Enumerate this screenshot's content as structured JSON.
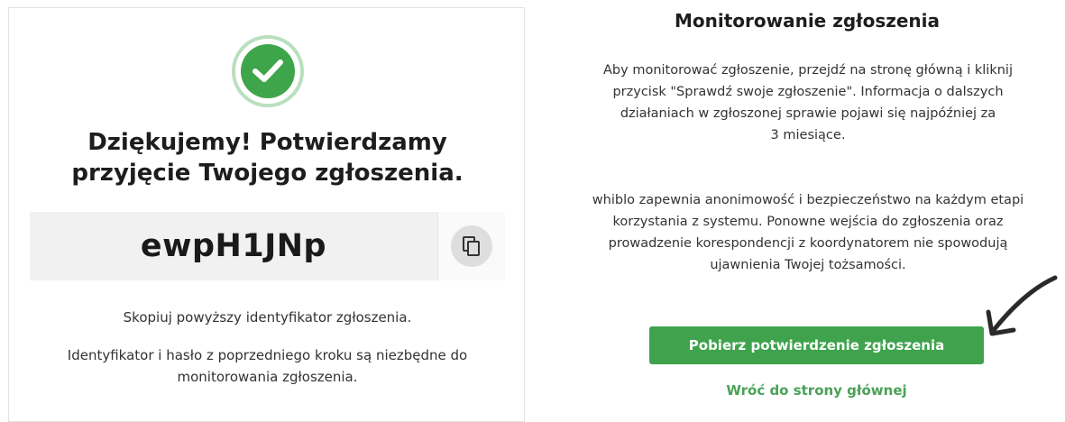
{
  "confirmation": {
    "heading_line1": "Dziękujemy! Potwierdzamy",
    "heading_line2": "przyjęcie Twojego zgłoszenia.",
    "report_id": "ewpH1JNp",
    "copy_hint": "Skopiuj powyższy identyfikator zgłoszenia.",
    "note_line1": "Identyfikator i hasło z poprzedniego kroku są niezbędne do",
    "note_line2": "monitorowania zgłoszenia."
  },
  "monitoring": {
    "title": "Monitorowanie zgłoszenia",
    "para1_line1": "Aby monitorować zgłoszenie, przejdź na stronę główną i kliknij",
    "para1_line2": "przycisk \"Sprawdź swoje zgłoszenie\". Informacja o dalszych",
    "para1_line3": "działaniach w zgłoszonej sprawie pojawi się najpóźniej za",
    "para1_line4": "3 miesiące.",
    "para2_line1": "whiblo zapewnia anonimowość i bezpieczeństwo na każdym etapi",
    "para2_line2": "korzystania z systemu. Ponowne wejścia do zgłoszenia oraz",
    "para2_line3": "prowadzenie korespondencji z koordynatorem nie spowodują",
    "para2_line4": "ujawnienia Twojej tożsamości.",
    "download_button": "Pobierz potwierdzenie zgłoszenia",
    "back_link": "Wróć do strony głównej"
  },
  "icons": {
    "success": "check-circle-icon",
    "copy": "copy-icon",
    "pointer": "hand-drawn-arrow-icon"
  },
  "colors": {
    "accent_green": "#3fa34d",
    "link_green": "#4aa257"
  }
}
